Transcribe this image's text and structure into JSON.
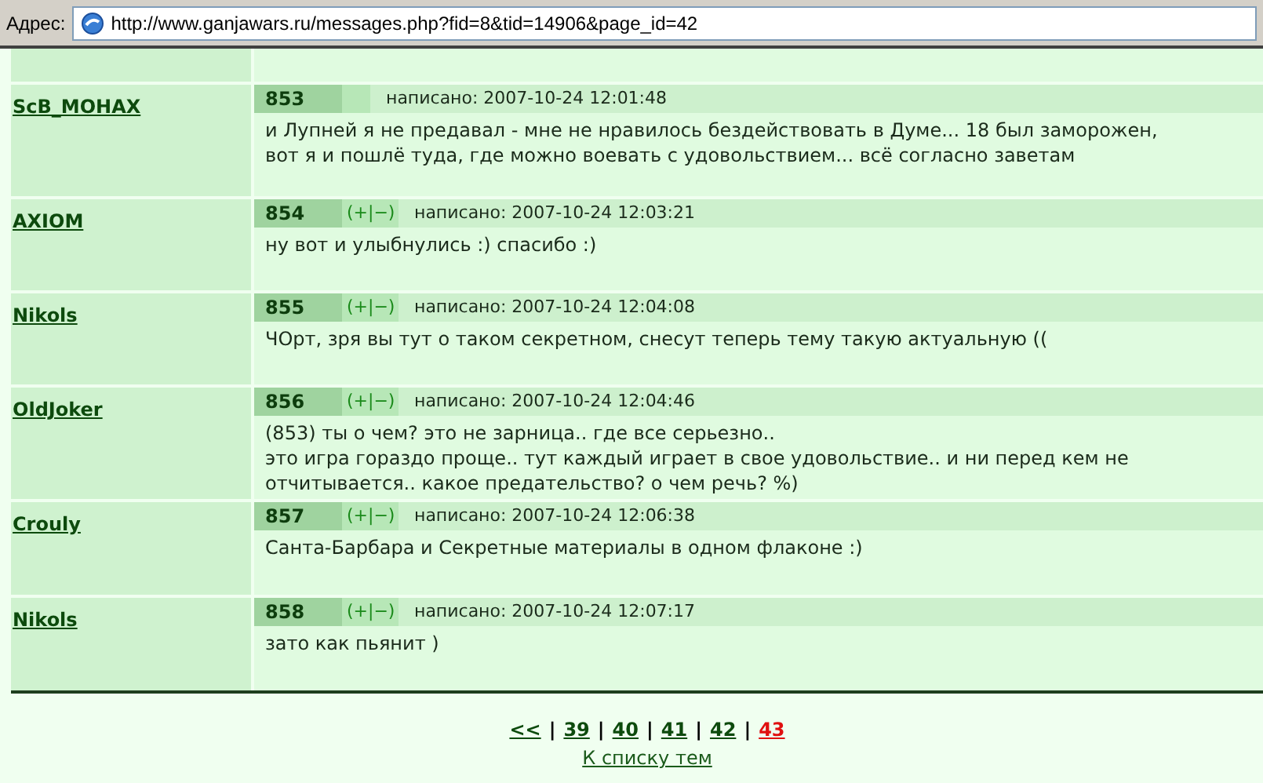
{
  "address_bar": {
    "label": "Адрес:",
    "url": "http://www.ganjawars.ru/messages.php?fid=8&tid=14906&page_id=42"
  },
  "posts": [
    {
      "author": "ScB_MOHAX",
      "number": "853",
      "written": "написано: 2007-10-24 12:01:48",
      "text": "и Лупней я не предавал - мне не нравилось бездействовать в Думе... 18 был заморожен, вот я и пошлё туда, где можно воевать с удовольствием... всё согласно заветам"
    },
    {
      "author": "AXIOM",
      "number": "854",
      "vote": "(+|−)",
      "written": "написано: 2007-10-24 12:03:21",
      "text": "ну вот и улыбнулись :) спасибо :)"
    },
    {
      "author": "Nikols",
      "number": "855",
      "vote": "(+|−)",
      "written": "написано: 2007-10-24 12:04:08",
      "text": "ЧОрт, зря вы тут о таком секретном, снесут теперь тему такую актуальную (("
    },
    {
      "author": "OldJoker",
      "number": "856",
      "vote": "(+|−)",
      "written": "написано: 2007-10-24 12:04:46",
      "text": "(853) ты о чем? это не зарница.. где все серьезно..\nэто игра гораздо проще.. тут каждый играет в свое удовольствие.. и ни перед кем не отчитывается.. какое предательство? о чем речь? %)"
    },
    {
      "author": "Crouly",
      "number": "857",
      "vote": "(+|−)",
      "written": "написано: 2007-10-24 12:06:38",
      "text": "Санта-Барбара и Секретные материалы в одном флаконе :)"
    },
    {
      "author": "Nikols",
      "number": "858",
      "vote": "(+|−)",
      "written": "написано: 2007-10-24 12:07:17",
      "text": "зато как пьянит )"
    }
  ],
  "pagination": [
    {
      "kind": "link",
      "label": "<<",
      "selected": false
    },
    {
      "kind": "separator",
      "label": "|"
    },
    {
      "kind": "link",
      "label": "39",
      "selected": false
    },
    {
      "kind": "separator",
      "label": "|"
    },
    {
      "kind": "link",
      "label": "40",
      "selected": false
    },
    {
      "kind": "separator",
      "label": "|"
    },
    {
      "kind": "link",
      "label": "41",
      "selected": false
    },
    {
      "kind": "separator",
      "label": "|"
    },
    {
      "kind": "link",
      "label": "42",
      "selected": false
    },
    {
      "kind": "separator",
      "label": "|"
    },
    {
      "kind": "link",
      "label": "43",
      "selected": true
    }
  ],
  "back_link": "К списку тем"
}
